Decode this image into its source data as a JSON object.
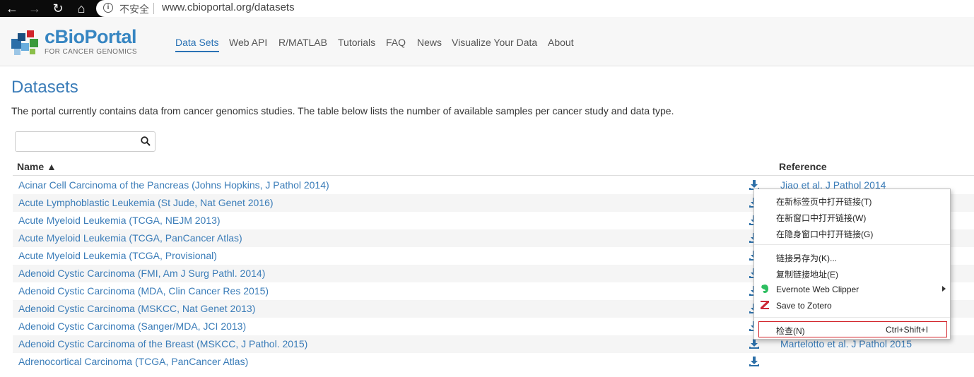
{
  "browser": {
    "back_icon": "arrow-left-icon",
    "forward_icon": "arrow-right-icon",
    "reload_icon": "reload-icon",
    "home_icon": "home-icon",
    "security_label": "不安全",
    "url": "www.cbioportal.org/datasets"
  },
  "site": {
    "logo_title": "cBioPortal",
    "logo_subtitle": "FOR CANCER GENOMICS",
    "nav": [
      "Data Sets",
      "Web API",
      "R/MATLAB",
      "Tutorials",
      "FAQ",
      "News",
      "Visualize Your Data",
      "About"
    ],
    "nav_active": "Data Sets"
  },
  "page": {
    "title": "Datasets",
    "intro": "The portal currently contains data from cancer genomics studies. The table below lists the number of available samples per cancer study and data type.",
    "search_value": "",
    "columns": {
      "name": "Name ▲",
      "reference": "Reference"
    },
    "rows": [
      {
        "name": "Acinar Cell Carcinoma of the Pancreas (Johns Hopkins, J Pathol 2014)",
        "reference": "Jiao et al. J Pathol 2014"
      },
      {
        "name": "Acute Lymphoblastic Leukemia (St Jude, Nat Genet 2016)",
        "reference": ""
      },
      {
        "name": "Acute Myeloid Leukemia (TCGA, NEJM 2013)",
        "reference": ""
      },
      {
        "name": "Acute Myeloid Leukemia (TCGA, PanCancer Atlas)",
        "reference": ""
      },
      {
        "name": "Acute Myeloid Leukemia (TCGA, Provisional)",
        "reference": ""
      },
      {
        "name": "Adenoid Cystic Carcinoma (FMI, Am J Surg Pathl. 2014)",
        "reference": ""
      },
      {
        "name": "Adenoid Cystic Carcinoma (MDA, Clin Cancer Res 2015)",
        "reference": ""
      },
      {
        "name": "Adenoid Cystic Carcinoma (MSKCC, Nat Genet 2013)",
        "reference": ""
      },
      {
        "name": "Adenoid Cystic Carcinoma (Sanger/MDA, JCI 2013)",
        "reference": ""
      },
      {
        "name": "Adenoid Cystic Carcinoma of the Breast (MSKCC, J Pathol. 2015)",
        "reference": "Martelotto et al. J Pathol 2015"
      },
      {
        "name": "Adrenocortical Carcinoma (TCGA, PanCancer Atlas)",
        "reference": ""
      }
    ]
  },
  "context_menu": {
    "items": [
      {
        "label": "在新标签页中打开链接(T)"
      },
      {
        "label": "在新窗口中打开链接(W)"
      },
      {
        "label": "在隐身窗口中打开链接(G)"
      },
      {
        "label": "链接另存为(K)..."
      },
      {
        "label": "复制链接地址(E)"
      },
      {
        "label": "Evernote Web Clipper",
        "icon": "evernote-icon",
        "has_submenu": true
      },
      {
        "label": "Save to Zotero",
        "icon": "zotero-icon"
      },
      {
        "label": "检查(N)",
        "shortcut": "Ctrl+Shift+I",
        "highlighted": true
      }
    ]
  },
  "colors": {
    "brand_blue": "#3786c2",
    "link_blue": "#3a7cb8",
    "highlight_red": "#d2232a",
    "evernote_green": "#2dbe60",
    "zotero_red": "#cc2936"
  }
}
